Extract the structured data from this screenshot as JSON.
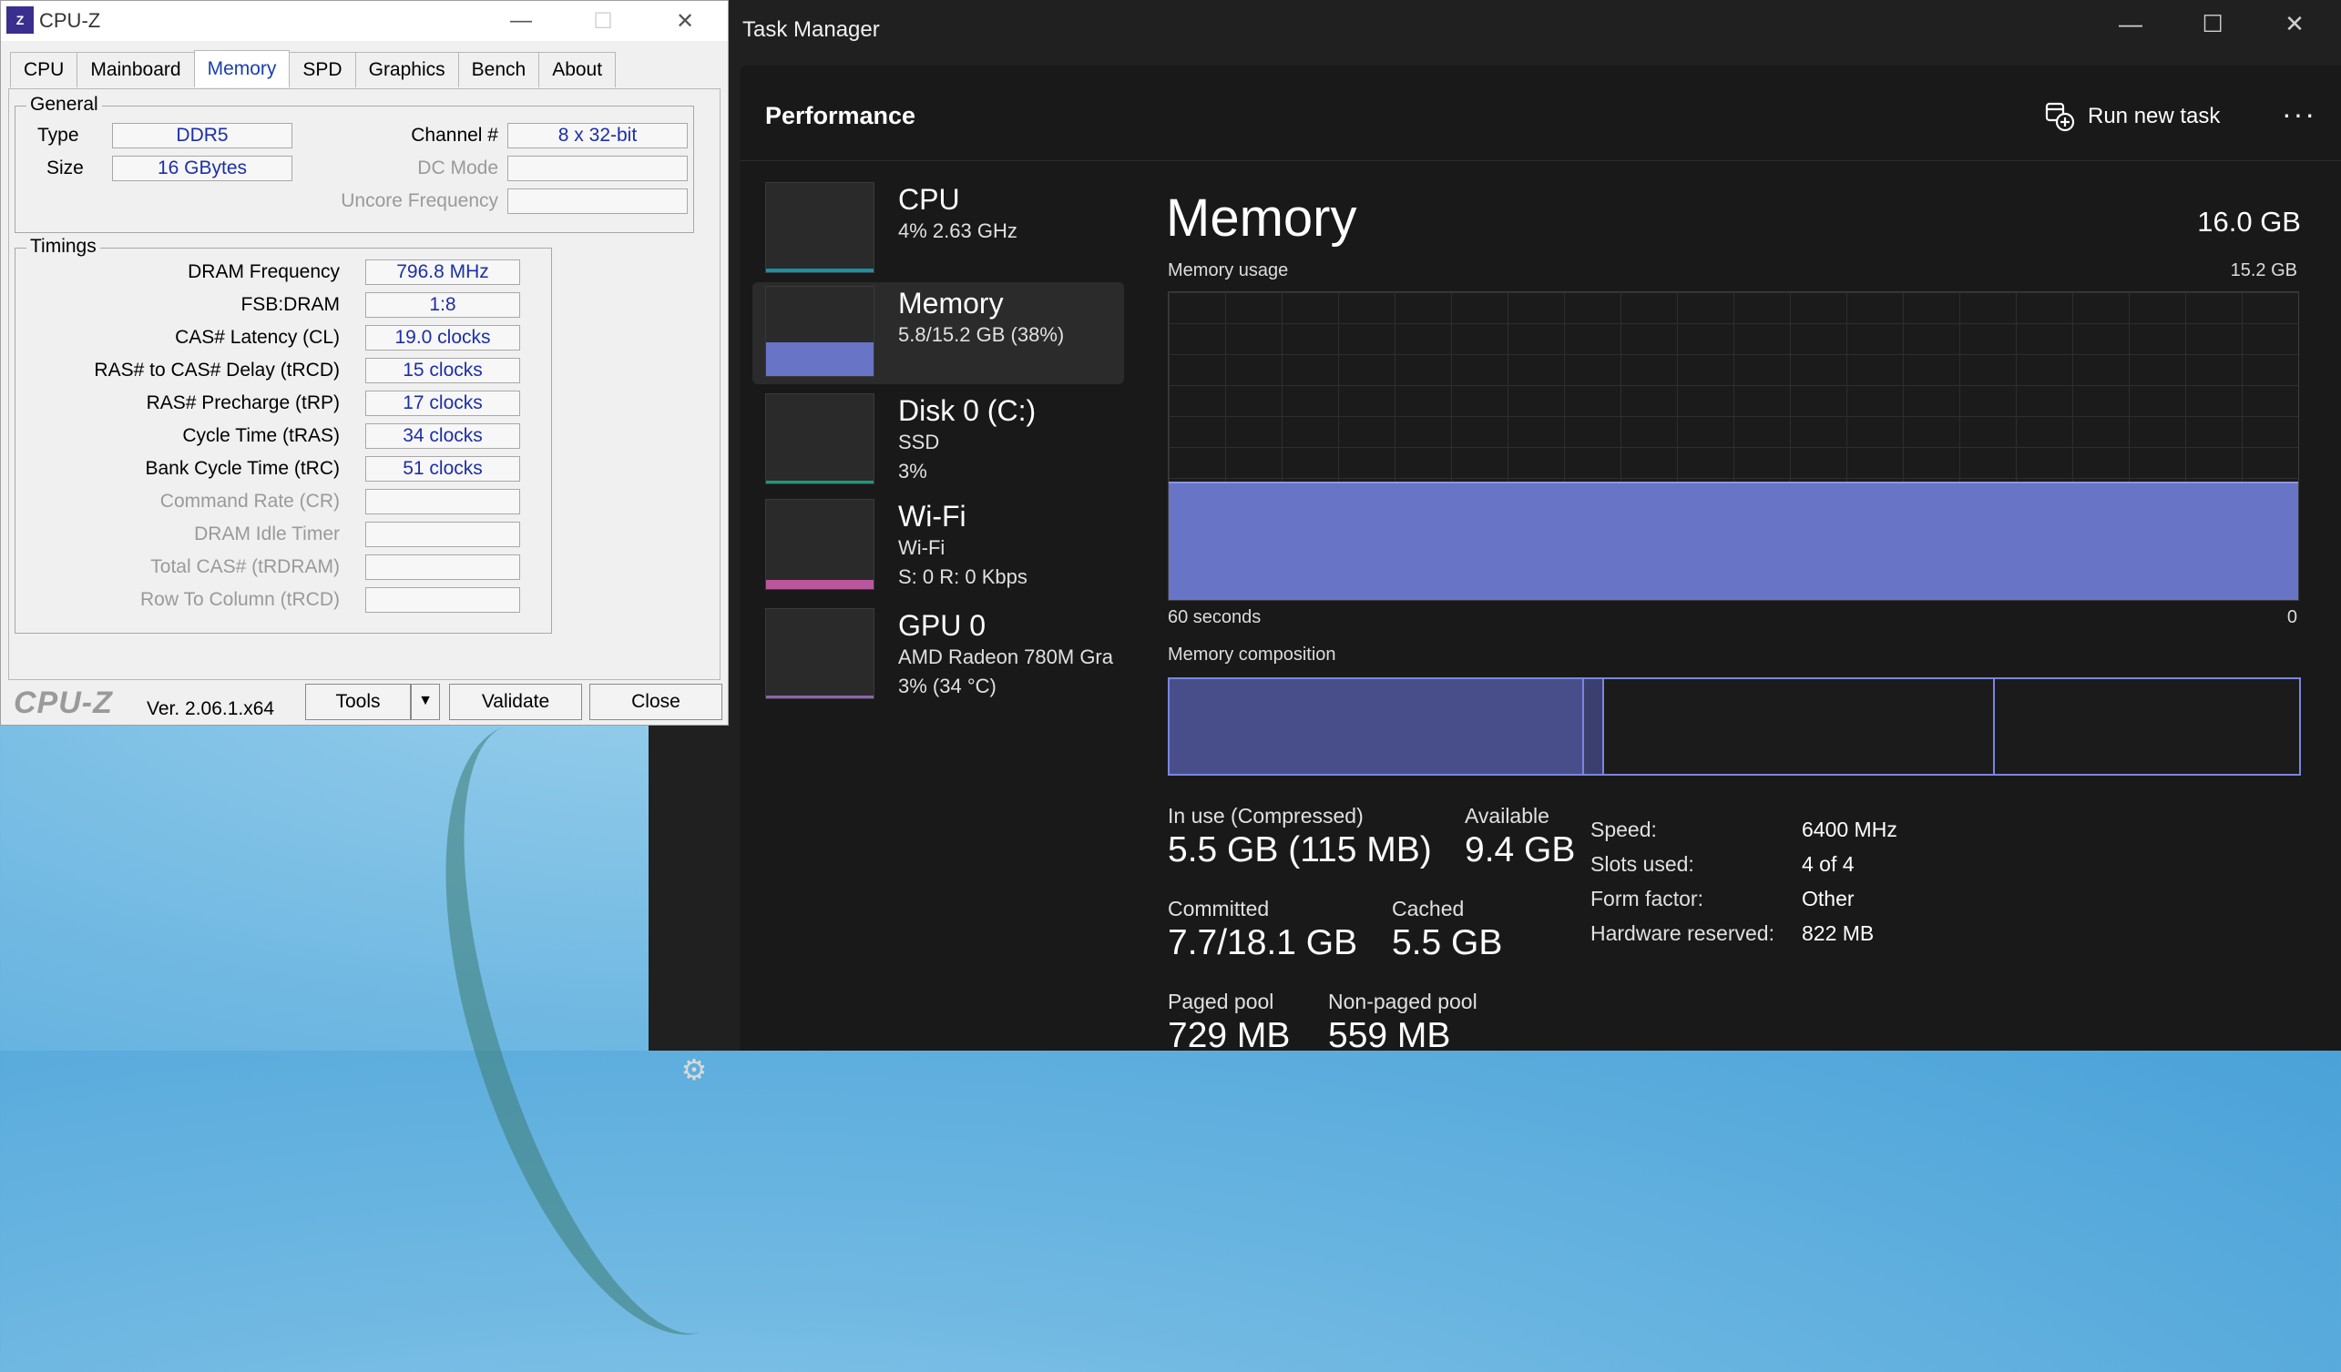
{
  "cpuz": {
    "title": "CPU-Z",
    "tabs": [
      "CPU",
      "Mainboard",
      "Memory",
      "SPD",
      "Graphics",
      "Bench",
      "About"
    ],
    "active_tab": "Memory",
    "general": {
      "title": "General",
      "type_label": "Type",
      "type_value": "DDR5",
      "size_label": "Size",
      "size_value": "16 GBytes",
      "channel_label": "Channel #",
      "channel_value": "8 x 32-bit",
      "dcmode_label": "DC Mode",
      "dcmode_value": "",
      "uncore_label": "Uncore Frequency",
      "uncore_value": ""
    },
    "timings": {
      "title": "Timings",
      "rows": [
        {
          "label": "DRAM Frequency",
          "value": "796.8 MHz",
          "dim": false
        },
        {
          "label": "FSB:DRAM",
          "value": "1:8",
          "dim": false
        },
        {
          "label": "CAS# Latency (CL)",
          "value": "19.0 clocks",
          "dim": false
        },
        {
          "label": "RAS# to CAS# Delay (tRCD)",
          "value": "15 clocks",
          "dim": false
        },
        {
          "label": "RAS# Precharge (tRP)",
          "value": "17 clocks",
          "dim": false
        },
        {
          "label": "Cycle Time (tRAS)",
          "value": "34 clocks",
          "dim": false
        },
        {
          "label": "Bank Cycle Time (tRC)",
          "value": "51 clocks",
          "dim": false
        },
        {
          "label": "Command Rate (CR)",
          "value": "",
          "dim": true
        },
        {
          "label": "DRAM Idle Timer",
          "value": "",
          "dim": true
        },
        {
          "label": "Total CAS# (tRDRAM)",
          "value": "",
          "dim": true
        },
        {
          "label": "Row To Column (tRCD)",
          "value": "",
          "dim": true
        }
      ]
    },
    "footer": {
      "logo": "CPU-Z",
      "version": "Ver. 2.06.1.x64",
      "tools": "Tools",
      "validate": "Validate",
      "close": "Close"
    }
  },
  "taskmanager": {
    "title": "Task Manager",
    "page_title": "Performance",
    "run_new_task": "Run new task",
    "more": "···",
    "sidebar": [
      {
        "name": "CPU",
        "lines": [
          "4%  2.63 GHz"
        ],
        "selected": false,
        "color": "#17a2b8",
        "level": 0.04
      },
      {
        "name": "Memory",
        "lines": [
          "5.8/15.2 GB (38%)"
        ],
        "selected": true,
        "color": "#6874c6",
        "level": 0.38
      },
      {
        "name": "Disk 0 (C:)",
        "lines": [
          "SSD",
          "3%"
        ],
        "selected": false,
        "color": "#1faa8c",
        "level": 0.03
      },
      {
        "name": "Wi-Fi",
        "lines": [
          "Wi-Fi",
          "S: 0  R: 0 Kbps"
        ],
        "selected": false,
        "color": "#d45fb0",
        "level": 0.1
      },
      {
        "name": "GPU 0",
        "lines": [
          "AMD Radeon 780M Gra",
          "3%  (34 °C)"
        ],
        "selected": false,
        "color": "#a070c8",
        "level": 0.03
      }
    ],
    "memory": {
      "title": "Memory",
      "total": "16.0 GB",
      "usage_label": "Memory usage",
      "usage_max": "15.2 GB",
      "usage_level": 0.38,
      "x_left": "60 seconds",
      "x_right": "0",
      "composition_label": "Memory composition",
      "composition": {
        "in_use": 0.367,
        "modified": 0.018,
        "standby": 0.346,
        "free": 0.269
      },
      "stats": {
        "in_use_label": "In use (Compressed)",
        "in_use_value": "5.5 GB (115 MB)",
        "available_label": "Available",
        "available_value": "9.4 GB",
        "committed_label": "Committed",
        "committed_value": "7.7/18.1 GB",
        "cached_label": "Cached",
        "cached_value": "5.5 GB",
        "paged_label": "Paged pool",
        "paged_value": "729 MB",
        "nonpaged_label": "Non-paged pool",
        "nonpaged_value": "559 MB"
      },
      "details": [
        {
          "key": "Speed:",
          "value": "6400 MHz"
        },
        {
          "key": "Slots used:",
          "value": "4 of 4"
        },
        {
          "key": "Form factor:",
          "value": "Other"
        },
        {
          "key": "Hardware reserved:",
          "value": "822 MB"
        }
      ]
    }
  },
  "colors": {
    "accent": "#6874c6",
    "tm_bg": "#191919",
    "cpuz_value": "#1d2fa8"
  }
}
